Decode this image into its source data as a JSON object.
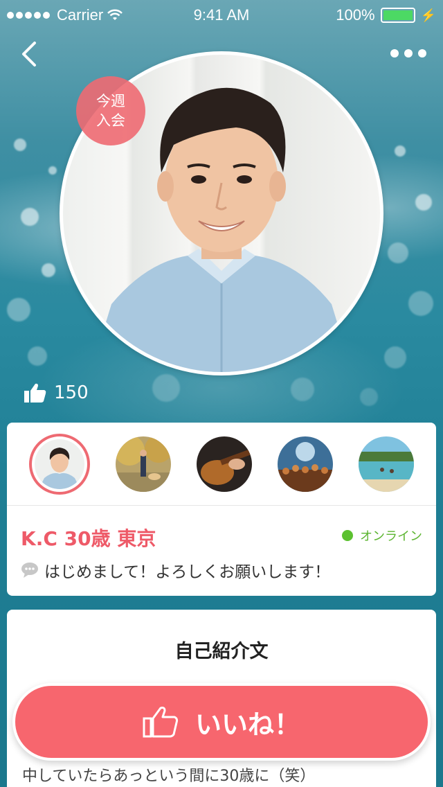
{
  "status_bar": {
    "carrier": "Carrier",
    "time": "9:41 AM",
    "battery": "100%"
  },
  "profile": {
    "badge_line1": "今週",
    "badge_line2": "入会",
    "like_count": "150",
    "name": "K.C 30歳 東京",
    "online_label": "オンライン",
    "message": "はじめまして！よろしくお願いします！"
  },
  "intro": {
    "title": "自己紹介文",
    "text": "中していたらあっという間に30歳に（笑）"
  },
  "like_button": {
    "label": "いいね！"
  },
  "colors": {
    "accent": "#ee5a68",
    "online": "#5cc130",
    "battery": "#4cd964"
  }
}
